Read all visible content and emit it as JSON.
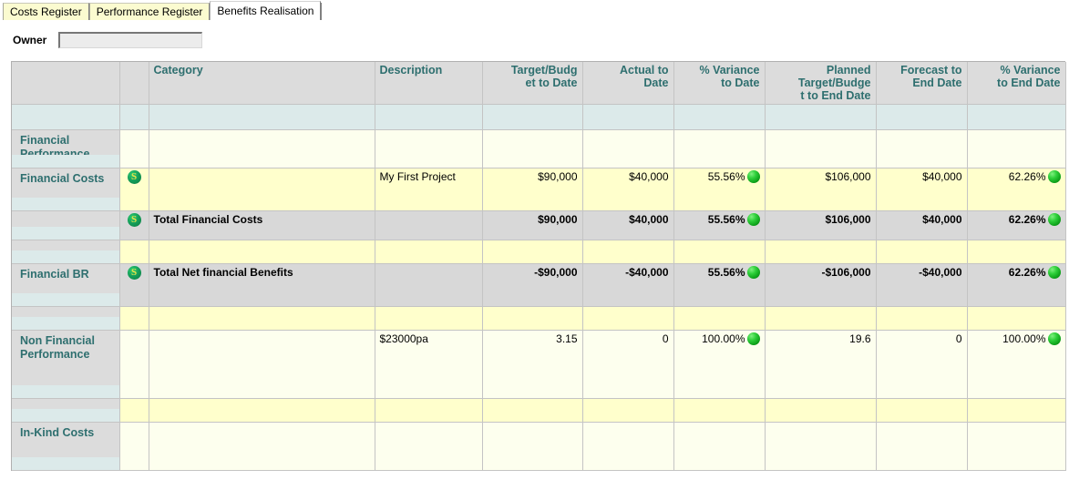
{
  "tabs": [
    {
      "label": "Costs Register",
      "active": false
    },
    {
      "label": "Performance Register",
      "active": false
    },
    {
      "label": "Benefits Realisation",
      "active": true
    }
  ],
  "owner": {
    "label": "Owner",
    "value": "",
    "placeholder": ""
  },
  "colors": {
    "header_bg": "#dcdcdc",
    "header_text": "#2e6f6f",
    "subheader_bg": "#dceaea",
    "row_yellow": "#ffffcc",
    "row_light_yellow": "#fdffee",
    "total_grey": "#d8d8d8",
    "status_green": "#16b020",
    "tab_inactive": "#fbfbd0",
    "tab_active": "#ffffff"
  },
  "grid": {
    "columns": [
      {
        "key": "section",
        "label": ""
      },
      {
        "key": "icon",
        "label": ""
      },
      {
        "key": "category",
        "label": "Category"
      },
      {
        "key": "description",
        "label": "Description"
      },
      {
        "key": "target_date",
        "label": "Target/Budget to Date"
      },
      {
        "key": "actual_date",
        "label": "Actual to Date"
      },
      {
        "key": "var_date",
        "label": "% Variance to Date"
      },
      {
        "key": "planned_end",
        "label": "Planned Target/Budget to End Date"
      },
      {
        "key": "forecast_end",
        "label": "Forecast to End Date"
      },
      {
        "key": "var_end",
        "label": "% Variance to End Date"
      }
    ],
    "header_lines": {
      "category": [
        "Category"
      ],
      "description": [
        "Description"
      ],
      "target_date": [
        "Target/Budg",
        "et to Date"
      ],
      "actual_date": [
        "Actual to",
        "Date"
      ],
      "var_date": [
        "% Variance",
        "to Date"
      ],
      "planned_end": [
        "Planned",
        "Target/Budge",
        "t to End Date"
      ],
      "forecast_end": [
        "Forecast to",
        "End Date"
      ],
      "var_end": [
        "% Variance",
        "to End Date"
      ]
    },
    "rows": [
      {
        "section": "Financial Performance",
        "icon": "",
        "category": "",
        "description": "",
        "target_date": "",
        "actual_date": "",
        "var_date": "",
        "var_date_status": "",
        "planned_end": "",
        "forecast_end": "",
        "var_end": "",
        "var_end_status": "",
        "style": "lyellow",
        "bold": false
      },
      {
        "section": "Financial Costs",
        "icon": "s-coin-icon",
        "category": "",
        "description": "My First Project",
        "target_date": "$90,000",
        "actual_date": "$40,000",
        "var_date": "55.56%",
        "var_date_status": "green",
        "planned_end": "$106,000",
        "forecast_end": "$40,000",
        "var_end": "62.26%",
        "var_end_status": "green",
        "style": "yellow",
        "bold": false
      },
      {
        "section": "",
        "icon": "s-coin-icon",
        "category": "Total Financial Costs",
        "description": "",
        "target_date": "$90,000",
        "actual_date": "$40,000",
        "var_date": "55.56%",
        "var_date_status": "green",
        "planned_end": "$106,000",
        "forecast_end": "$40,000",
        "var_end": "62.26%",
        "var_end_status": "green",
        "style": "grey",
        "bold": true
      },
      {
        "section": "",
        "icon": "",
        "category": "",
        "description": "",
        "target_date": "",
        "actual_date": "",
        "var_date": "",
        "var_date_status": "",
        "planned_end": "",
        "forecast_end": "",
        "var_end": "",
        "var_end_status": "",
        "style": "yellow",
        "bold": false
      },
      {
        "section": "Financial BR",
        "icon": "s-coin-icon",
        "category": "Total Net financial Benefits",
        "description": "",
        "target_date": "-$90,000",
        "actual_date": "-$40,000",
        "var_date": "55.56%",
        "var_date_status": "green",
        "planned_end": "-$106,000",
        "forecast_end": "-$40,000",
        "var_end": "62.26%",
        "var_end_status": "green",
        "style": "grey",
        "bold": true
      },
      {
        "section": "",
        "icon": "",
        "category": "",
        "description": "",
        "target_date": "",
        "actual_date": "",
        "var_date": "",
        "var_date_status": "",
        "planned_end": "",
        "forecast_end": "",
        "var_end": "",
        "var_end_status": "",
        "style": "yellow",
        "bold": false
      },
      {
        "section": "Non Financial Performance",
        "icon": "",
        "category": "",
        "description": "$23000pa",
        "target_date": "3.15",
        "actual_date": "0",
        "var_date": "100.00%",
        "var_date_status": "green",
        "planned_end": "19.6",
        "forecast_end": "0",
        "var_end": "100.00%",
        "var_end_status": "green",
        "style": "lyellow",
        "bold": false
      },
      {
        "section": "",
        "icon": "",
        "category": "",
        "description": "",
        "target_date": "",
        "actual_date": "",
        "var_date": "",
        "var_date_status": "",
        "planned_end": "",
        "forecast_end": "",
        "var_end": "",
        "var_end_status": "",
        "style": "yellow",
        "bold": false
      },
      {
        "section": "In-Kind Costs",
        "icon": "",
        "category": "",
        "description": "",
        "target_date": "",
        "actual_date": "",
        "var_date": "",
        "var_date_status": "",
        "planned_end": "",
        "forecast_end": "",
        "var_end": "",
        "var_end_status": "",
        "style": "lyellow",
        "bold": false
      }
    ]
  }
}
